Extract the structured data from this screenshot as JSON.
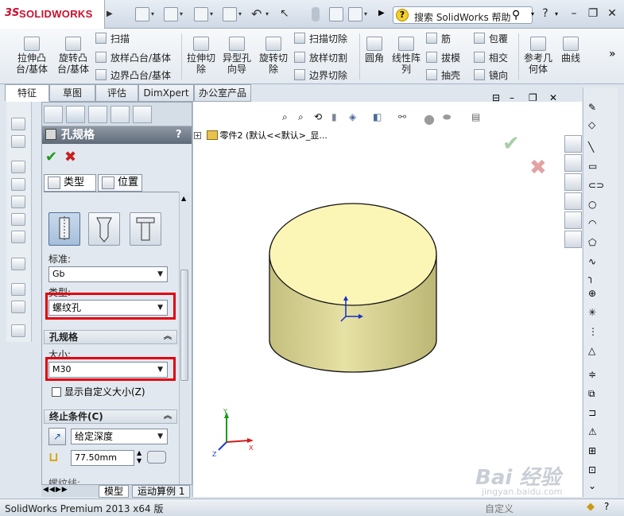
{
  "app": {
    "logo_mark": "3S",
    "logo_text": "SOLIDWORKS",
    "search_placeholder": "搜索 SolidWorks 帮助",
    "help_glyph": "?",
    "status_text": "SolidWorks Premium 2013 x64 版",
    "status_right": "自定义",
    "watermark": "Bai 经验",
    "watermark_url": "jingyan.baidu.com"
  },
  "ribbon": {
    "boss_extrude": "拉伸凸\n台/基体",
    "revolve_boss": "旋转凸\n台/基体",
    "sweep": "扫描",
    "loft": "放样凸台/基体",
    "boundary_boss": "边界凸台/基体",
    "cut_extrude": "拉伸切\n除",
    "hole_wizard": "异型孔\n向导",
    "revolve_cut": "旋转切\n除",
    "swept_cut": "扫描切除",
    "lofted_cut": "放样切割",
    "boundary_cut": "边界切除",
    "fillet": "圆角",
    "linear_pattern": "线性阵\n列",
    "rib": "筋",
    "draft": "拔模",
    "shell": "抽壳",
    "wrap": "包覆",
    "intersect": "相交",
    "mirror": "镜向",
    "ref_geometry": "参考几\n何体",
    "curves": "曲线",
    "more": "»"
  },
  "tabs": [
    {
      "label": "特征"
    },
    {
      "label": "草图"
    },
    {
      "label": "评估"
    },
    {
      "label": "DimXpert"
    },
    {
      "label": "办公室产品"
    }
  ],
  "pm": {
    "title": "孔规格",
    "help": "?",
    "ok": "✔",
    "cancel": "✖",
    "subtab_type": "类型",
    "subtab_position": "位置",
    "standard_label": "标准:",
    "standard_value": "Gb",
    "type_label": "类型:",
    "type_value": "螺纹孔",
    "spec_section": "孔规格",
    "size_label": "大小:",
    "size_value": "M30",
    "custom_size_label": "显示自定义大小(Z)",
    "end_condition_section": "终止条件(C)",
    "end_condition_value": "给定深度",
    "depth_value": "77.50mm",
    "thread_label": "螺纹线:"
  },
  "tree": {
    "expand": "+",
    "label": "零件2 (默认<<默认>_显..."
  },
  "bottom_tabs": [
    {
      "label": "模型"
    },
    {
      "label": "运动算例 1"
    }
  ],
  "triad": {
    "x": "X",
    "y": "Y",
    "z": "Z"
  },
  "colors": {
    "cylinder_top": "#fbf5b6",
    "cylinder_side": "#d9d496",
    "highlight_red": "#e3000f",
    "ok_green": "#1a9a1a",
    "cancel_red": "#c81e1e"
  }
}
